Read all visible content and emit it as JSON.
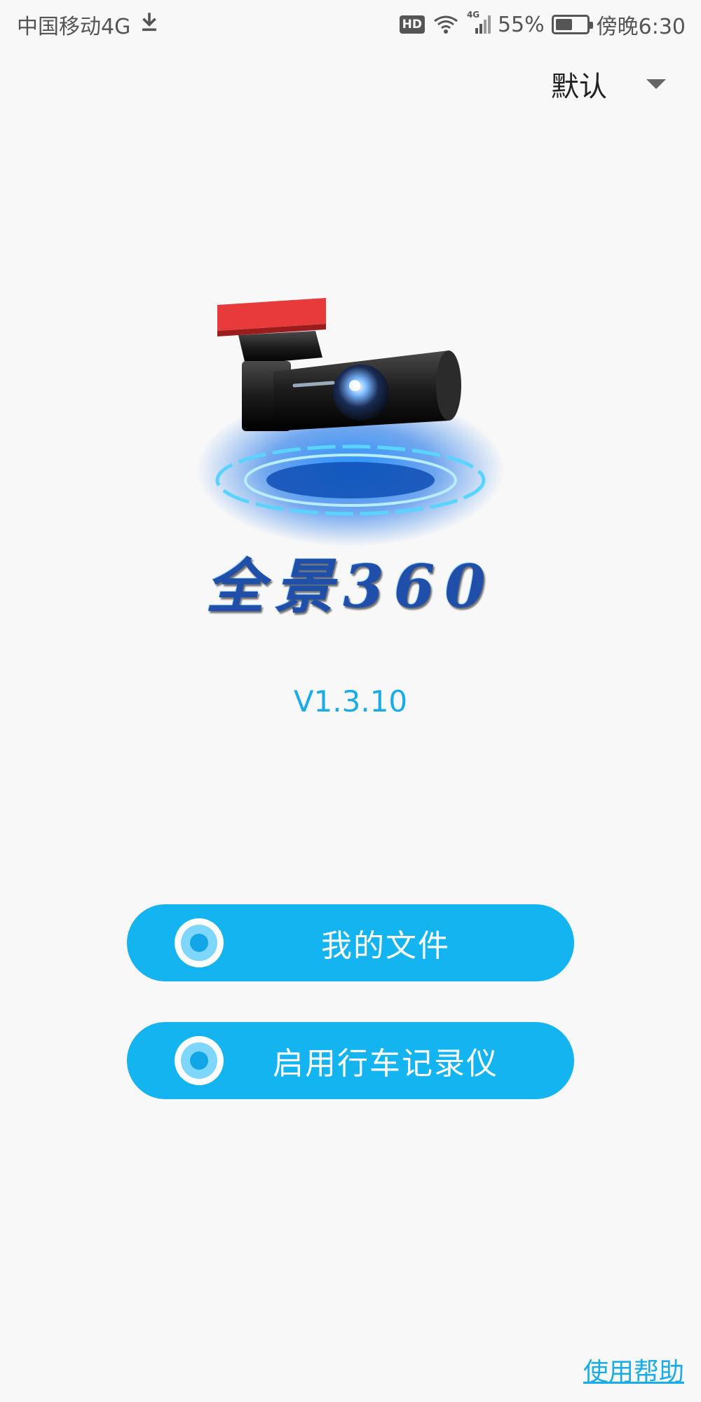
{
  "status_bar": {
    "carrier": "中国移动4G",
    "hd_badge": "HD",
    "network": "4G",
    "battery_percent": "55%",
    "battery_level": 0.55,
    "time": "傍晚6:30"
  },
  "language_select": {
    "selected": "默认"
  },
  "logo": {
    "text": "全景360"
  },
  "version": "V1.3.10",
  "buttons": {
    "my_files": "我的文件",
    "start_recorder": "启用行车记录仪"
  },
  "help_link": "使用帮助",
  "colors": {
    "accent": "#13b4ef",
    "version_text": "#1aace6",
    "background": "#f8f8f8"
  }
}
